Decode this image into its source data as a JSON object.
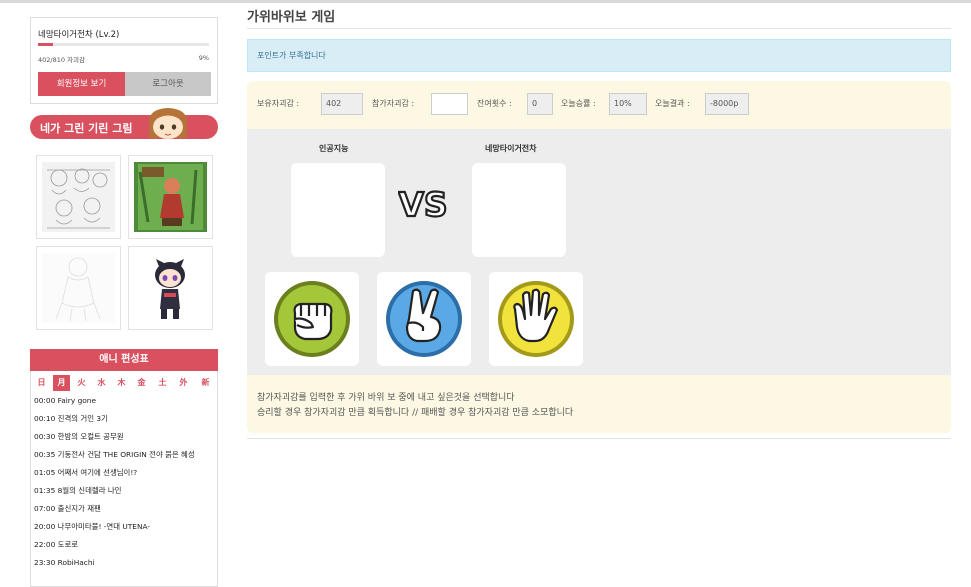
{
  "user": {
    "name": "네망타이거전차 (Lv.2)",
    "xp_text": "402/810 자괴감",
    "xp_percent_text": "9%",
    "xp_fraction": 0.09,
    "profile_button": "회원정보 보기",
    "logout_button": "로그아웃"
  },
  "gallery": {
    "title": "네가 그린 기린 그림"
  },
  "anime": {
    "title": "애니 편성표",
    "days": [
      "日",
      "月",
      "火",
      "水",
      "木",
      "金",
      "土",
      "外",
      "新"
    ],
    "active_day": "月",
    "schedule": [
      "00:00  Fairy gone",
      "00:10  진격의 거인 3기",
      "00:30  한밤의 오컬트 공무원",
      "00:35  기동전사 건담 THE ORIGIN 전야 붉은 혜성",
      "01:05  어째서 여기에 선생님이!?",
      "01:35  8월의 신데렐라 나인",
      "07:00  출신지가 재팬",
      "20:00  나무아미타불! -연대 UTENA-",
      "22:00  도로로",
      "23:30  RobiHachi"
    ]
  },
  "main": {
    "title": "가위바위보 게임",
    "alert": "포인트가 부족합니다",
    "stats": {
      "own_label": "보유자괴감 :",
      "own_value": "402",
      "bet_label": "참가자괴감 :",
      "bet_value": "",
      "remaining_label": "잔여횟수 :",
      "remaining_value": "0",
      "winrate_label": "오늘승률 :",
      "winrate_value": "10%",
      "result_label": "오늘결과 :",
      "result_value": "-8000p"
    },
    "opponent_name": "인공지능",
    "player_name": "네망타이거전차",
    "vs_text": "VS",
    "instructions": [
      "참가자괴감를 입력한 후 가위 바위 보 중에 내고 싶은것을 선택합니다",
      "승리할 경우 참가자괴감 만큼 획득합니다 // 패배할 경우 참가자괴감 만큼 소모합니다"
    ]
  },
  "colors": {
    "accent": "#d9505f",
    "rock": "#a4c639",
    "scissors": "#5aa9e6",
    "paper": "#f2e33c",
    "alert_bg": "#d9edf7",
    "panel_bg": "#fcf8e3"
  }
}
